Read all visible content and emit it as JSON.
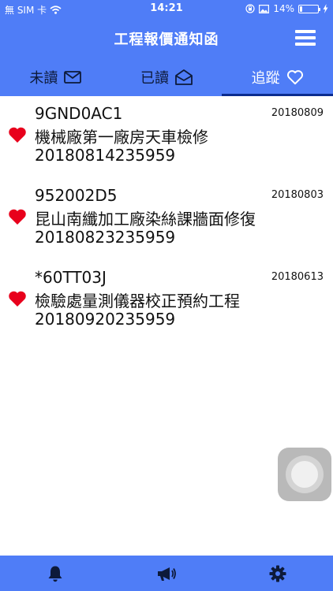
{
  "status_bar": {
    "carrier": "無 SIM 卡",
    "time": "14:21",
    "battery": "14%",
    "battery_level": 0.14
  },
  "header": {
    "title": "工程報價通知函",
    "menu_icon": "hamburger-menu-icon"
  },
  "tabs": [
    {
      "label": "未讀",
      "icon": "envelope-closed-icon",
      "active": false
    },
    {
      "label": "已讀",
      "icon": "envelope-open-icon",
      "active": false
    },
    {
      "label": "追蹤",
      "icon": "heart-outline-icon",
      "active": true
    }
  ],
  "items": [
    {
      "code": "9GND0AC1",
      "date": "20180809",
      "name": "機械廠第一廠房天車檢修",
      "deadline": "20180814235959",
      "tracked": true
    },
    {
      "code": "952002D5",
      "date": "20180803",
      "name": "昆山南纖加工廠染絲課牆面修復",
      "deadline": "20180823235959",
      "tracked": true
    },
    {
      "code": "*60TT03J",
      "date": "20180613",
      "name": "檢驗處量測儀器校正預約工程",
      "deadline": "20180920235959",
      "tracked": true
    }
  ],
  "bottom_nav": [
    {
      "icon": "bell-icon"
    },
    {
      "icon": "megaphone-icon"
    },
    {
      "icon": "gear-icon"
    }
  ],
  "colors": {
    "primary": "#4f7df7",
    "active_tab_underline": "#0b2c8f",
    "heart": "#e8001c"
  }
}
